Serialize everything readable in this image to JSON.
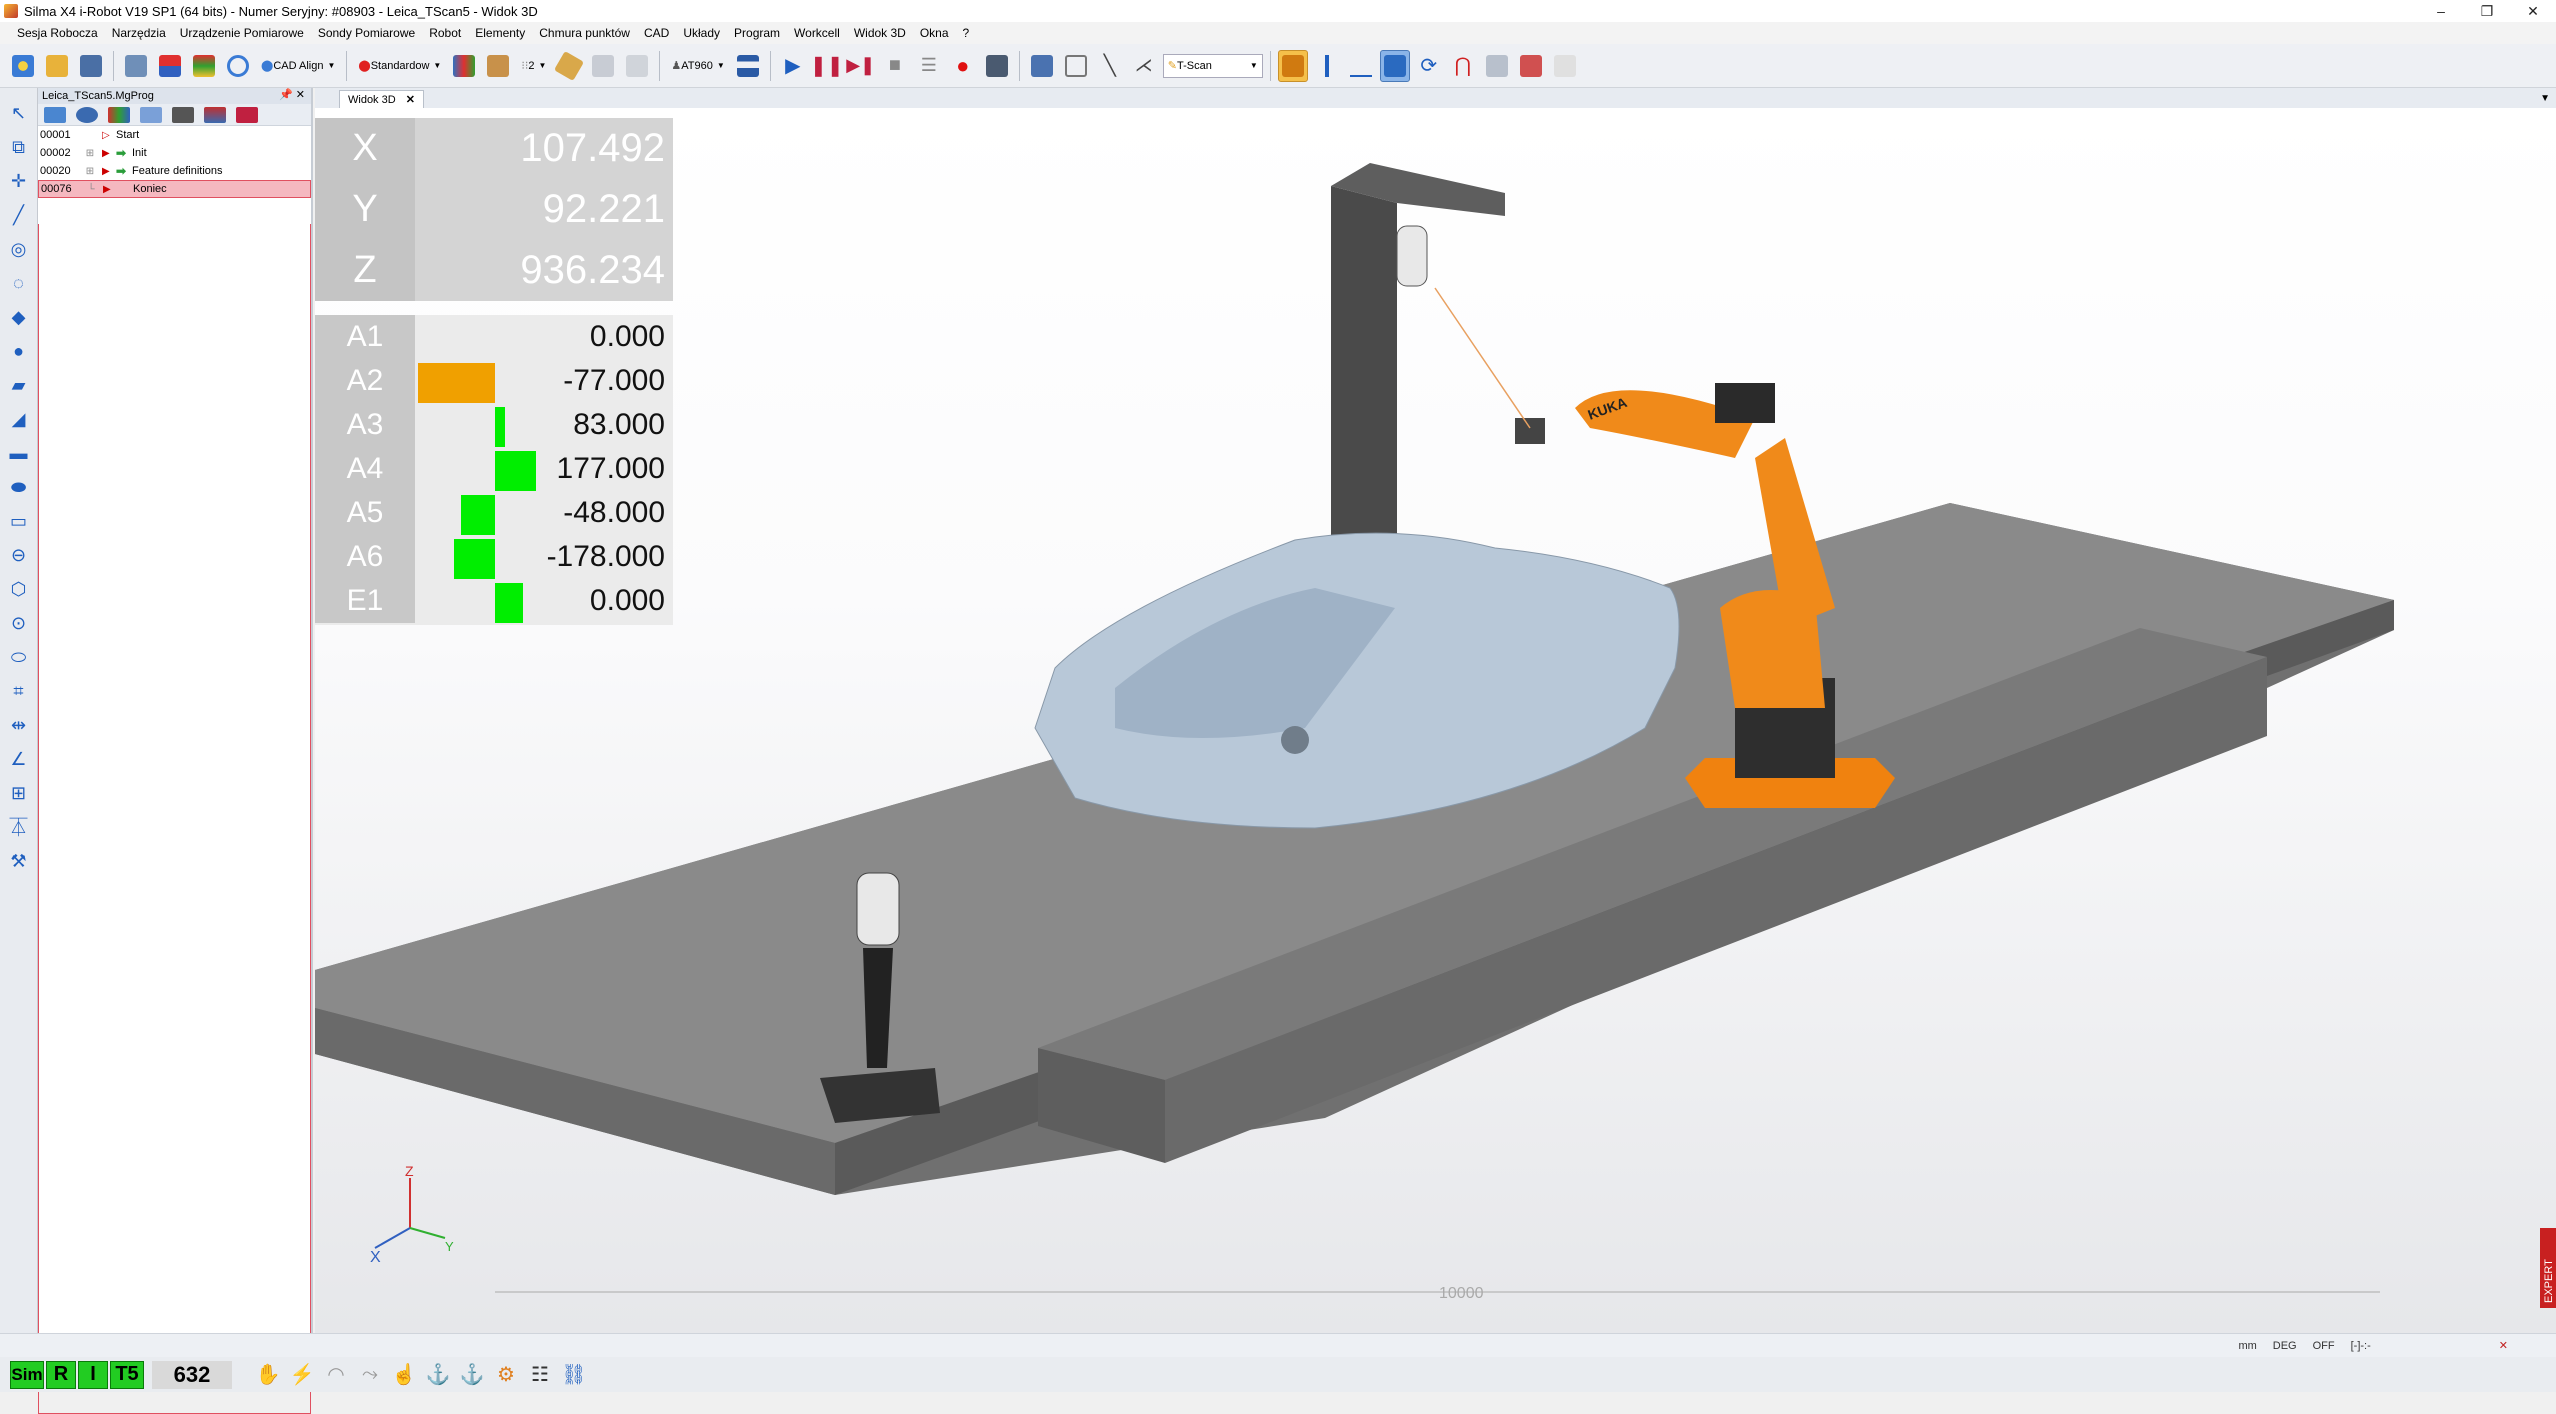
{
  "window": {
    "title": "Silma X4 i-Robot V19 SP1 (64 bits) - Numer Seryjny: #08903 - Leica_TScan5 - Widok 3D",
    "controls": [
      "–",
      "❐",
      "✕"
    ]
  },
  "menu": [
    "Sesja Robocza",
    "Narzędzia",
    "Urządzenie Pomiarowe",
    "Sondy Pomiarowe",
    "Robot",
    "Elementy",
    "Chmura punktów",
    "CAD",
    "Układy",
    "Program",
    "Workcell",
    "Widok 3D",
    "Okna",
    "?"
  ],
  "toolbar": {
    "cad_align": "CAD Align",
    "standard": "Standardow",
    "layers": "2",
    "tracker": "AT960",
    "probe": "T-Scan"
  },
  "program_panel": {
    "title": "Leica_TScan5.MgProg",
    "controls": "📌 ✕",
    "rows": [
      {
        "num": "00001",
        "label": "Start"
      },
      {
        "num": "00002",
        "label": "Init"
      },
      {
        "num": "00020",
        "label": "Feature definitions"
      },
      {
        "num": "00076",
        "label": "Koniec"
      }
    ]
  },
  "view": {
    "tab": "Widok 3D",
    "tab_close": "✕",
    "scale_label": "10000",
    "axis": {
      "x": "X",
      "y": "Y",
      "z": "Z"
    },
    "expert_badge": "EXPERT",
    "robot_brand": "KUKA"
  },
  "coordinates": {
    "x_label": "X",
    "x": "107.492",
    "y_label": "Y",
    "y": "92.221",
    "z_label": "Z",
    "z": "936.234"
  },
  "joints": [
    {
      "label": "A1",
      "value": "0.000",
      "bar_from": 0.48,
      "bar_to": 0.48,
      "color": "#f0a000"
    },
    {
      "label": "A2",
      "value": "-77.000",
      "bar_from": 0.01,
      "bar_to": 0.31,
      "color": "#f0a000"
    },
    {
      "label": "A3",
      "value": "83.000",
      "bar_from": 0.31,
      "bar_to": 0.35,
      "color": "#00ee00"
    },
    {
      "label": "A4",
      "value": "177.000",
      "bar_from": 0.31,
      "bar_to": 0.47,
      "color": "#00ee00"
    },
    {
      "label": "A5",
      "value": "-48.000",
      "bar_from": 0.18,
      "bar_to": 0.31,
      "color": "#00ee00"
    },
    {
      "label": "A6",
      "value": "-178.000",
      "bar_from": 0.15,
      "bar_to": 0.31,
      "color": "#00ee00"
    },
    {
      "label": "E1",
      "value": "0.000",
      "bar_from": 0.31,
      "bar_to": 0.42,
      "color": "#00ee00"
    }
  ],
  "status": {
    "units": "mm",
    "angle": "DEG",
    "state": "OFF",
    "coord": "[-]-:-"
  },
  "bottom": {
    "sim": "Sim",
    "r": "R",
    "i": "I",
    "t5": "T5",
    "counter": "632"
  }
}
